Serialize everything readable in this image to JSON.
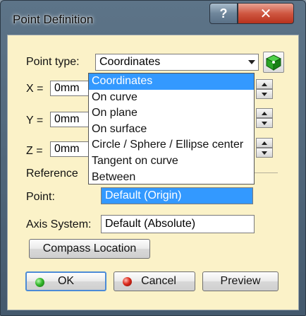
{
  "window": {
    "title": "Point Definition",
    "help_label": "?",
    "close_label": "✕"
  },
  "point_type": {
    "label": "Point type:",
    "value": "Coordinates",
    "options": [
      "Coordinates",
      "On curve",
      "On plane",
      "On surface",
      "Circle / Sphere / Ellipse center",
      "Tangent on curve",
      "Between"
    ],
    "selected_index": 0,
    "pick_icon": "green-point-cube-icon"
  },
  "coordinates": {
    "x_label": "X =",
    "x_value": "0mm",
    "y_label": "Y =",
    "y_value": "0mm",
    "z_label": "Z =",
    "z_value": "0mm"
  },
  "reference": {
    "group_label": "Reference",
    "point_label": "Point:",
    "point_value": "Default (Origin)",
    "axis_label": "Axis System:",
    "axis_value": "Default (Absolute)"
  },
  "buttons": {
    "compass": "Compass Location",
    "ok": "OK",
    "cancel": "Cancel",
    "preview": "Preview"
  },
  "colors": {
    "client_bg": "#fbf2c8",
    "selection": "#3399ff",
    "close_red": "#cf5741"
  }
}
